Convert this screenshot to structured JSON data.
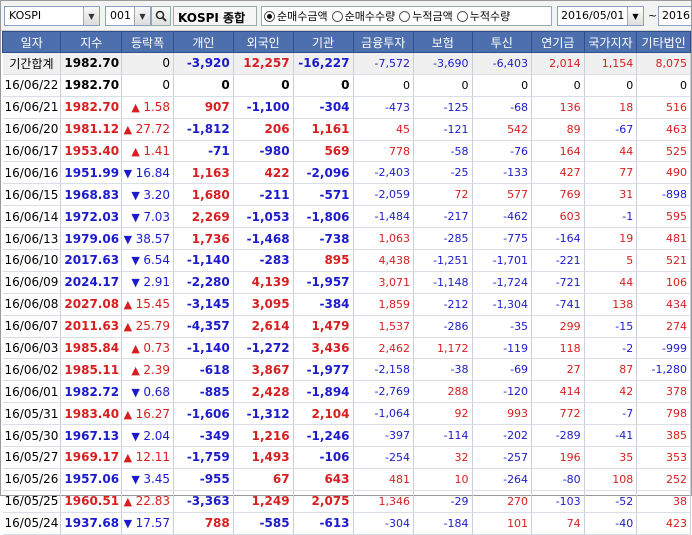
{
  "toolbar": {
    "market_combo": "KOSPI",
    "code_combo": "001",
    "market_name": "KOSPI 종합",
    "radios": [
      {
        "label": "순매수금액",
        "selected": true
      },
      {
        "label": "순매수수량",
        "selected": false
      },
      {
        "label": "누적금액",
        "selected": false
      },
      {
        "label": "누적수량",
        "selected": false
      }
    ],
    "start_date": "2016/05/01",
    "tilde": "~",
    "end_date": "2016"
  },
  "table": {
    "headers": [
      "일자",
      "지수",
      "등락폭",
      "개인",
      "외국인",
      "기관",
      "금융투자",
      "보험",
      "투신",
      "연기금",
      "국가지자",
      "기타법인"
    ],
    "rows": [
      {
        "date": "기간합계",
        "index": "1982.70",
        "dir": "",
        "chg": "0",
        "cols": [
          "-3,920",
          "12,257",
          "-16,227",
          "-7,572",
          "-3,690",
          "-6,403",
          "2,014",
          "1,154",
          "8,075"
        ],
        "summary": true
      },
      {
        "date": "16/06/22",
        "index": "1982.70",
        "dir": "",
        "chg": "0",
        "cols": [
          "0",
          "0",
          "0",
          "0",
          "0",
          "0",
          "0",
          "0",
          "0"
        ],
        "zero": true
      },
      {
        "date": "16/06/21",
        "index": "1982.70",
        "dir": "up",
        "chg": "1.58",
        "cols": [
          "907",
          "-1,100",
          "-304",
          "-473",
          "-125",
          "-68",
          "136",
          "18",
          "516"
        ]
      },
      {
        "date": "16/06/20",
        "index": "1981.12",
        "dir": "up",
        "chg": "27.72",
        "cols": [
          "-1,812",
          "206",
          "1,161",
          "45",
          "-121",
          "542",
          "89",
          "-67",
          "463"
        ]
      },
      {
        "date": "16/06/17",
        "index": "1953.40",
        "dir": "up",
        "chg": "1.41",
        "cols": [
          "-71",
          "-980",
          "569",
          "778",
          "-58",
          "-76",
          "164",
          "44",
          "525"
        ]
      },
      {
        "date": "16/06/16",
        "index": "1951.99",
        "dir": "down",
        "chg": "16.84",
        "cols": [
          "1,163",
          "422",
          "-2,096",
          "-2,403",
          "-25",
          "-133",
          "427",
          "77",
          "490"
        ]
      },
      {
        "date": "16/06/15",
        "index": "1968.83",
        "dir": "down",
        "chg": "3.20",
        "cols": [
          "1,680",
          "-211",
          "-571",
          "-2,059",
          "72",
          "577",
          "769",
          "31",
          "-898"
        ]
      },
      {
        "date": "16/06/14",
        "index": "1972.03",
        "dir": "down",
        "chg": "7.03",
        "cols": [
          "2,269",
          "-1,053",
          "-1,806",
          "-1,484",
          "-217",
          "-462",
          "603",
          "-1",
          "595"
        ]
      },
      {
        "date": "16/06/13",
        "index": "1979.06",
        "dir": "down",
        "chg": "38.57",
        "cols": [
          "1,736",
          "-1,468",
          "-738",
          "1,063",
          "-285",
          "-775",
          "-164",
          "19",
          "481"
        ]
      },
      {
        "date": "16/06/10",
        "index": "2017.63",
        "dir": "down",
        "chg": "6.54",
        "cols": [
          "-1,140",
          "-283",
          "895",
          "4,438",
          "-1,251",
          "-1,701",
          "-221",
          "5",
          "521"
        ]
      },
      {
        "date": "16/06/09",
        "index": "2024.17",
        "dir": "down",
        "chg": "2.91",
        "cols": [
          "-2,280",
          "4,139",
          "-1,957",
          "3,071",
          "-1,148",
          "-1,724",
          "-721",
          "44",
          "106"
        ]
      },
      {
        "date": "16/06/08",
        "index": "2027.08",
        "dir": "up",
        "chg": "15.45",
        "cols": [
          "-3,145",
          "3,095",
          "-384",
          "1,859",
          "-212",
          "-1,304",
          "-741",
          "138",
          "434"
        ]
      },
      {
        "date": "16/06/07",
        "index": "2011.63",
        "dir": "up",
        "chg": "25.79",
        "cols": [
          "-4,357",
          "2,614",
          "1,479",
          "1,537",
          "-286",
          "-35",
          "299",
          "-15",
          "274"
        ]
      },
      {
        "date": "16/06/03",
        "index": "1985.84",
        "dir": "up",
        "chg": "0.73",
        "cols": [
          "-1,140",
          "-1,272",
          "3,436",
          "2,462",
          "1,172",
          "-119",
          "118",
          "-2",
          "-999"
        ]
      },
      {
        "date": "16/06/02",
        "index": "1985.11",
        "dir": "up",
        "chg": "2.39",
        "cols": [
          "-618",
          "3,867",
          "-1,977",
          "-2,158",
          "-38",
          "-69",
          "27",
          "87",
          "-1,280"
        ]
      },
      {
        "date": "16/06/01",
        "index": "1982.72",
        "dir": "down",
        "chg": "0.68",
        "cols": [
          "-885",
          "2,428",
          "-1,894",
          "-2,769",
          "288",
          "-120",
          "414",
          "42",
          "378"
        ]
      },
      {
        "date": "16/05/31",
        "index": "1983.40",
        "dir": "up",
        "chg": "16.27",
        "cols": [
          "-1,606",
          "-1,312",
          "2,104",
          "-1,064",
          "92",
          "993",
          "772",
          "-7",
          "798"
        ]
      },
      {
        "date": "16/05/30",
        "index": "1967.13",
        "dir": "down",
        "chg": "2.04",
        "cols": [
          "-349",
          "1,216",
          "-1,246",
          "-397",
          "-114",
          "-202",
          "-289",
          "-41",
          "385"
        ]
      },
      {
        "date": "16/05/27",
        "index": "1969.17",
        "dir": "up",
        "chg": "12.11",
        "cols": [
          "-1,759",
          "1,493",
          "-106",
          "-254",
          "32",
          "-257",
          "196",
          "35",
          "353"
        ]
      },
      {
        "date": "16/05/26",
        "index": "1957.06",
        "dir": "down",
        "chg": "3.45",
        "cols": [
          "-955",
          "67",
          "643",
          "481",
          "10",
          "-264",
          "-80",
          "108",
          "252"
        ]
      },
      {
        "date": "16/05/25",
        "index": "1960.51",
        "dir": "up",
        "chg": "22.83",
        "cols": [
          "-3,363",
          "1,249",
          "2,075",
          "1,346",
          "-29",
          "270",
          "-103",
          "-52",
          "38"
        ]
      },
      {
        "date": "16/05/24",
        "index": "1937.68",
        "dir": "down",
        "chg": "17.57",
        "cols": [
          "788",
          "-585",
          "-613",
          "-304",
          "-184",
          "101",
          "74",
          "-40",
          "423"
        ]
      }
    ]
  },
  "colors": {
    "up": "#d81e1e",
    "down": "#1b1bcc",
    "header_bg": "#4d6fae"
  }
}
